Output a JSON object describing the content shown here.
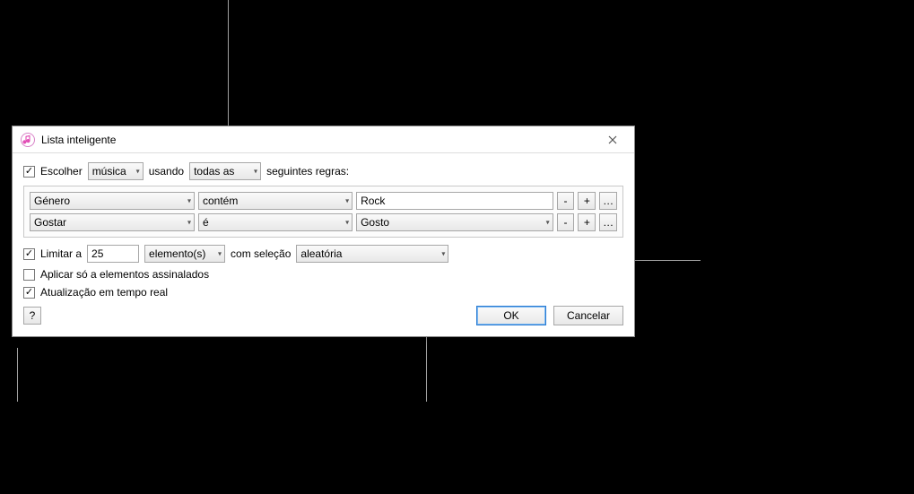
{
  "titlebar": {
    "title": "Lista inteligente"
  },
  "match": {
    "escolher_label": "Escolher",
    "media_selected": "música",
    "usando_label": "usando",
    "scope_selected": "todas as",
    "suffix_label": "seguintes regras:"
  },
  "rules": [
    {
      "field": "Género",
      "operator": "contém",
      "value": "Rock",
      "value_is_select": false
    },
    {
      "field": "Gostar",
      "operator": "é",
      "value": "Gosto",
      "value_is_select": true
    }
  ],
  "limit": {
    "label": "Limitar a",
    "value": "25",
    "unit_selected": "elemento(s)",
    "selection_label": "com seleção",
    "selection_mode": "aleatória"
  },
  "options": {
    "match_checked_label": "Aplicar só a elementos assinalados",
    "live_update_label": "Atualização em tempo real"
  },
  "buttons": {
    "help": "?",
    "ok": "OK",
    "cancel": "Cancelar",
    "minus": "-",
    "plus": "+",
    "more": "…"
  },
  "icons": {
    "music_note_color": "#e24bb5"
  }
}
